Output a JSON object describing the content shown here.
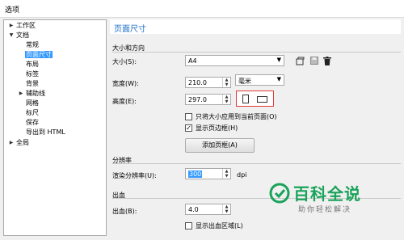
{
  "window": {
    "title": "选项"
  },
  "tree": [
    {
      "label": "工作区",
      "expander": "▶"
    },
    {
      "label": "文档",
      "expander": "▼"
    },
    {
      "label": "常规",
      "expander": ""
    },
    {
      "label": "页面尺寸",
      "expander": ""
    },
    {
      "label": "布局",
      "expander": ""
    },
    {
      "label": "标签",
      "expander": ""
    },
    {
      "label": "背景",
      "expander": ""
    },
    {
      "label": "辅助线",
      "expander": "▶"
    },
    {
      "label": "网格",
      "expander": ""
    },
    {
      "label": "标尺",
      "expander": ""
    },
    {
      "label": "保存",
      "expander": ""
    },
    {
      "label": "导出到 HTML",
      "expander": ""
    },
    {
      "label": "全局",
      "expander": "▶"
    }
  ],
  "panel": {
    "title": "页面尺寸",
    "size_section": "大小和方向",
    "size_label": "大小(S):",
    "size_value": "A4",
    "width_label": "宽度(W):",
    "width_value": "210.0",
    "unit_value": "毫米",
    "height_label": "高度(E):",
    "height_value": "297.0",
    "only_current": "只将大小应用到当前页面(O)",
    "show_border": "显示页边框(H)",
    "show_border_checked": true,
    "only_current_checked": false,
    "add_frame": "添加页框(A)",
    "resolution_section": "分辨率",
    "render_label": "渲染分辨率(U):",
    "render_value": "300",
    "render_unit": "dpi",
    "bleed_section": "出血",
    "bleed_label": "出血(B):",
    "bleed_value": "4.0",
    "show_bleed": "显示出血区域(L)",
    "show_bleed_checked": false
  },
  "watermark": {
    "title": "百科全说",
    "subtitle": "助你轻松解决"
  },
  "colors": {
    "accent": "#1e6fc7",
    "selection": "#3399ff",
    "orientation_border": "#e23b3b",
    "watermark": "#1aa35a"
  }
}
